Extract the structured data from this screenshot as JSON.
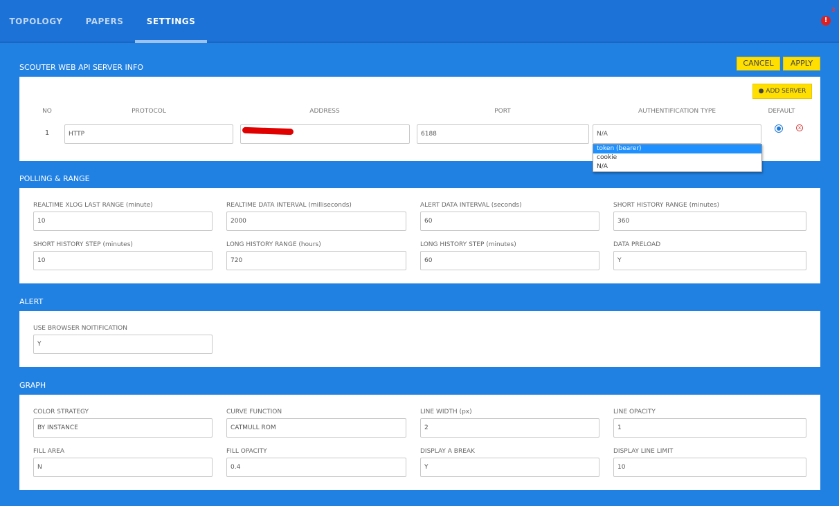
{
  "nav": {
    "tabs": [
      {
        "label": "TOPOLOGY",
        "active": false
      },
      {
        "label": "PAPERS",
        "active": false
      },
      {
        "label": "SETTINGS",
        "active": true
      }
    ],
    "alert_icon": "alert-icon",
    "alert_count": "3"
  },
  "actions": {
    "cancel_label": "CANCEL",
    "apply_label": "APPLY"
  },
  "server_info": {
    "title": "SCOUTER WEB API SERVER INFO",
    "add_server_label": "ADD SERVER",
    "columns": [
      "NO",
      "PROTOCOL",
      "ADDRESS",
      "PORT",
      "AUTHENTIFICATION TYPE",
      "DEFAULT"
    ],
    "row": {
      "no": "1",
      "protocol": "HTTP",
      "port": "6188",
      "auth_type": "N/A"
    },
    "auth_options": [
      "token (bearer)",
      "cookie",
      "N/A"
    ],
    "auth_highlighted": "token (bearer)"
  },
  "polling": {
    "title": "POLLING & RANGE",
    "fields": [
      {
        "label": "REALTIME XLOG LAST RANGE (minute)",
        "value": "10"
      },
      {
        "label": "REALTIME DATA INTERVAL (milliseconds)",
        "value": "2000"
      },
      {
        "label": "ALERT DATA INTERVAL (seconds)",
        "value": "60"
      },
      {
        "label": "SHORT HISTORY RANGE (minutes)",
        "value": "360"
      },
      {
        "label": "SHORT HISTORY STEP (minutes)",
        "value": "10"
      },
      {
        "label": "LONG HISTORY RANGE (hours)",
        "value": "720"
      },
      {
        "label": "LONG HISTORY STEP (minutes)",
        "value": "60"
      },
      {
        "label": "DATA PRELOAD",
        "value": "Y"
      }
    ]
  },
  "alert": {
    "title": "ALERT",
    "fields": [
      {
        "label": "USE BROWSER NOITIFICATION",
        "value": "Y"
      }
    ]
  },
  "graph": {
    "title": "GRAPH",
    "fields": [
      {
        "label": "COLOR STRATEGY",
        "value": "BY INSTANCE"
      },
      {
        "label": "CURVE FUNCTION",
        "value": "CATMULL ROM"
      },
      {
        "label": "LINE WIDTH (px)",
        "value": "2"
      },
      {
        "label": "LINE OPACITY",
        "value": "1"
      },
      {
        "label": "FILL AREA",
        "value": "N"
      },
      {
        "label": "FILL OPACITY",
        "value": "0.4"
      },
      {
        "label": "DISPLAY A BREAK",
        "value": "Y"
      },
      {
        "label": "DISPLAY LINE LIMIT",
        "value": "10"
      }
    ]
  },
  "colors": {
    "background": "#2181e2",
    "accent": "#ffdf00",
    "selection": "#1e90ff"
  }
}
